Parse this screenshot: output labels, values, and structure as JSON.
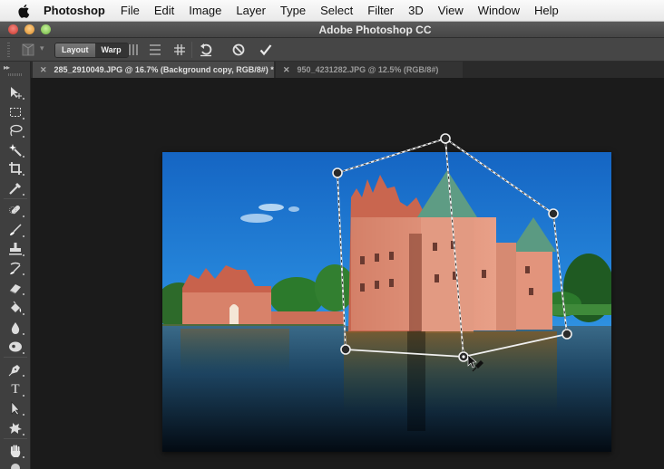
{
  "menubar": {
    "apple_icon": "apple-logo-icon",
    "app_name": "Photoshop",
    "items": [
      "File",
      "Edit",
      "Image",
      "Layer",
      "Type",
      "Select",
      "Filter",
      "3D",
      "View",
      "Window",
      "Help"
    ]
  },
  "window": {
    "title": "Adobe Photoshop CC",
    "controls": [
      "close",
      "minimize",
      "zoom"
    ]
  },
  "options_bar": {
    "preset_icon": "puppet-warp-preset-icon",
    "mode_segment": {
      "options": [
        "Layout",
        "Warp"
      ],
      "selected": "Layout"
    },
    "grid_buttons": [
      "split-vertical-icon",
      "split-horizontal-icon",
      "split-grid-icon"
    ],
    "reset_icon": "reset-undo-icon",
    "cancel_icon": "cancel-icon",
    "commit_icon": "commit-checkmark-icon"
  },
  "tabs": [
    {
      "label": "285_2910049.JPG @ 16.7% (Background copy, RGB/8#) *",
      "active": true
    },
    {
      "label": "950_4231282.JPG @ 12.5% (RGB/8#)",
      "active": false
    }
  ],
  "toolbar": {
    "collapse_label": "▸▸",
    "tools": [
      "move-tool",
      "rectangular-marquee-tool",
      "lasso-tool",
      "magic-wand-tool",
      "crop-tool",
      "eyedropper-tool",
      "spot-healing-brush-tool",
      "brush-tool",
      "clone-stamp-tool",
      "history-brush-tool",
      "eraser-tool",
      "paint-bucket-tool",
      "blur-tool",
      "dodge-tool",
      "pen-tool",
      "type-tool",
      "path-selection-tool",
      "custom-shape-tool",
      "hand-tool",
      "zoom-tool"
    ],
    "type_tool_glyph": "T"
  },
  "canvas": {
    "document": "285_2910049.JPG",
    "subject": "red brick moated castle with green copper-roofed towers, blue sky, reflection in water",
    "warp_mode": "Perspective Warp (Layout)",
    "warp_handle_count": 6
  },
  "colors": {
    "menubar_bg": "#f0f0f0",
    "chrome_bg": "#464646",
    "toolbar_bg": "#3f3f3f",
    "canvas_bg": "#1b1b1b",
    "sky": "#1e7ad0",
    "brick": "#d7806a",
    "roof_green": "#5d9a82",
    "water": "#1b3650"
  }
}
